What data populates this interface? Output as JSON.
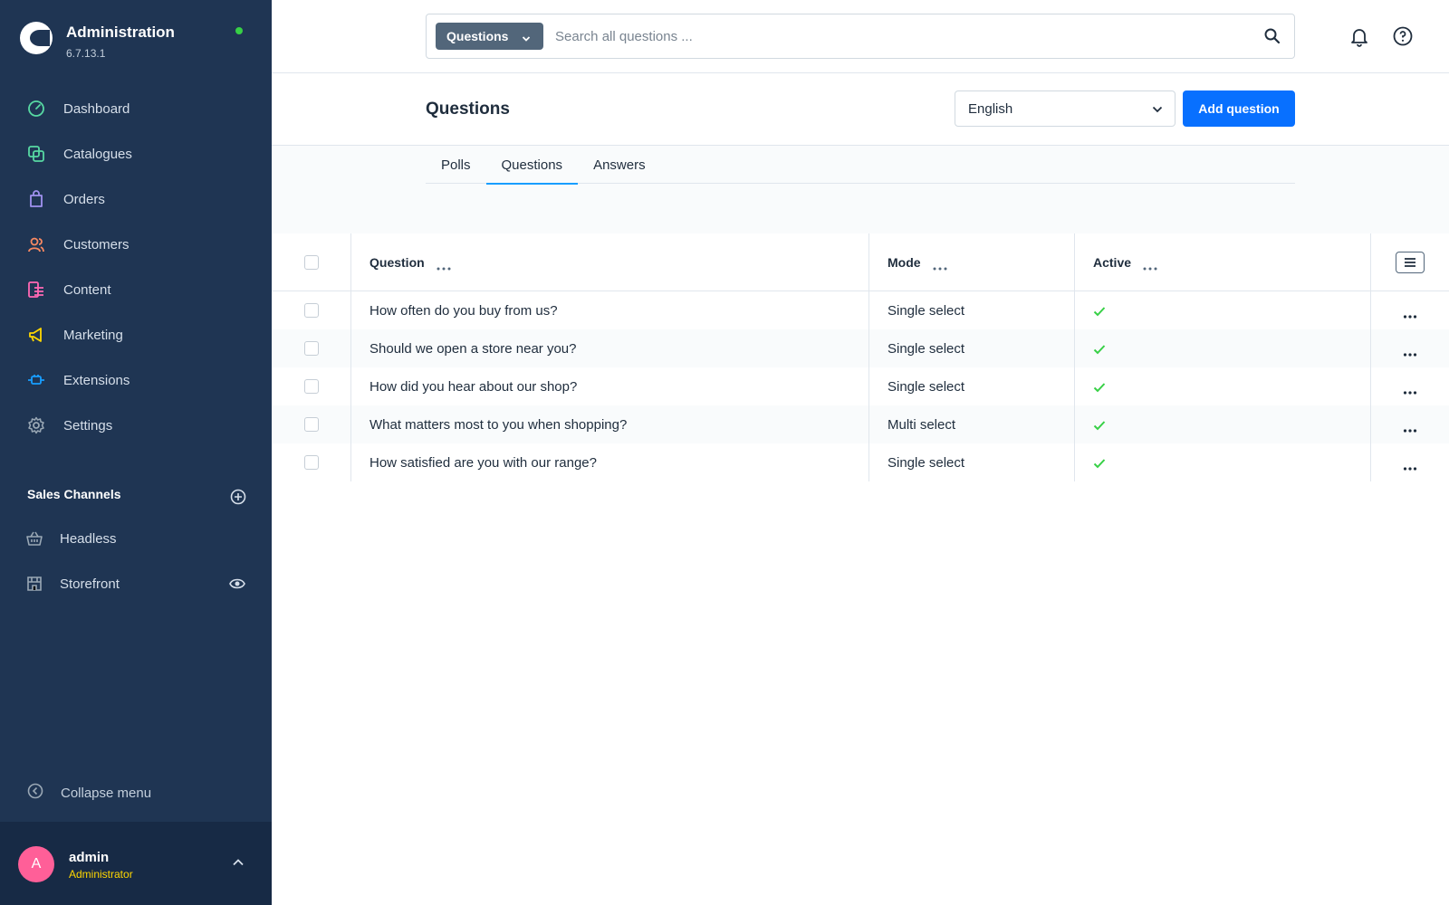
{
  "sidebar": {
    "brand": {
      "title": "Administration",
      "version": "6.7.13.1"
    },
    "nav": [
      {
        "label": "Dashboard",
        "icon": "dashboard-icon",
        "color": "#57d9a3"
      },
      {
        "label": "Catalogues",
        "icon": "catalogue-icon",
        "color": "#57d9a3"
      },
      {
        "label": "Orders",
        "icon": "orders-icon",
        "color": "#a092f0"
      },
      {
        "label": "Customers",
        "icon": "customers-icon",
        "color": "#f88962"
      },
      {
        "label": "Content",
        "icon": "content-icon",
        "color": "#ff68b4"
      },
      {
        "label": "Marketing",
        "icon": "marketing-icon",
        "color": "#ffd700"
      },
      {
        "label": "Extensions",
        "icon": "extensions-icon",
        "color": "#189eff"
      },
      {
        "label": "Settings",
        "icon": "settings-icon",
        "color": "#9aa8b5"
      }
    ],
    "sales_channels": {
      "title": "Sales Channels",
      "items": [
        {
          "label": "Headless",
          "icon": "basket-icon"
        },
        {
          "label": "Storefront",
          "icon": "store-icon"
        }
      ]
    },
    "collapse_label": "Collapse menu",
    "user": {
      "initial": "A",
      "name": "admin",
      "role": "Administrator"
    }
  },
  "topbar": {
    "search_type": "Questions",
    "search_placeholder": "Search all questions ..."
  },
  "smartbar": {
    "title": "Questions",
    "language": "English",
    "add_button": "Add question"
  },
  "tabs": [
    {
      "label": "Polls",
      "active": false
    },
    {
      "label": "Questions",
      "active": true
    },
    {
      "label": "Answers",
      "active": false
    }
  ],
  "grid": {
    "columns": {
      "question": "Question",
      "mode": "Mode",
      "active": "Active"
    },
    "rows": [
      {
        "question": "How often do you buy from us?",
        "mode": "Single select",
        "active": true
      },
      {
        "question": "Should we open a store near you?",
        "mode": "Single select",
        "active": true
      },
      {
        "question": "How did you hear about our shop?",
        "mode": "Single select",
        "active": true
      },
      {
        "question": "What matters most to you when shopping?",
        "mode": "Multi select",
        "active": true
      },
      {
        "question": "How satisfied are you with our range?",
        "mode": "Single select",
        "active": true
      }
    ]
  },
  "colors": {
    "sidebar_bg": "#1f3553",
    "accent": "#0870ff",
    "tab_active": "#189eff",
    "check": "#37d046"
  }
}
